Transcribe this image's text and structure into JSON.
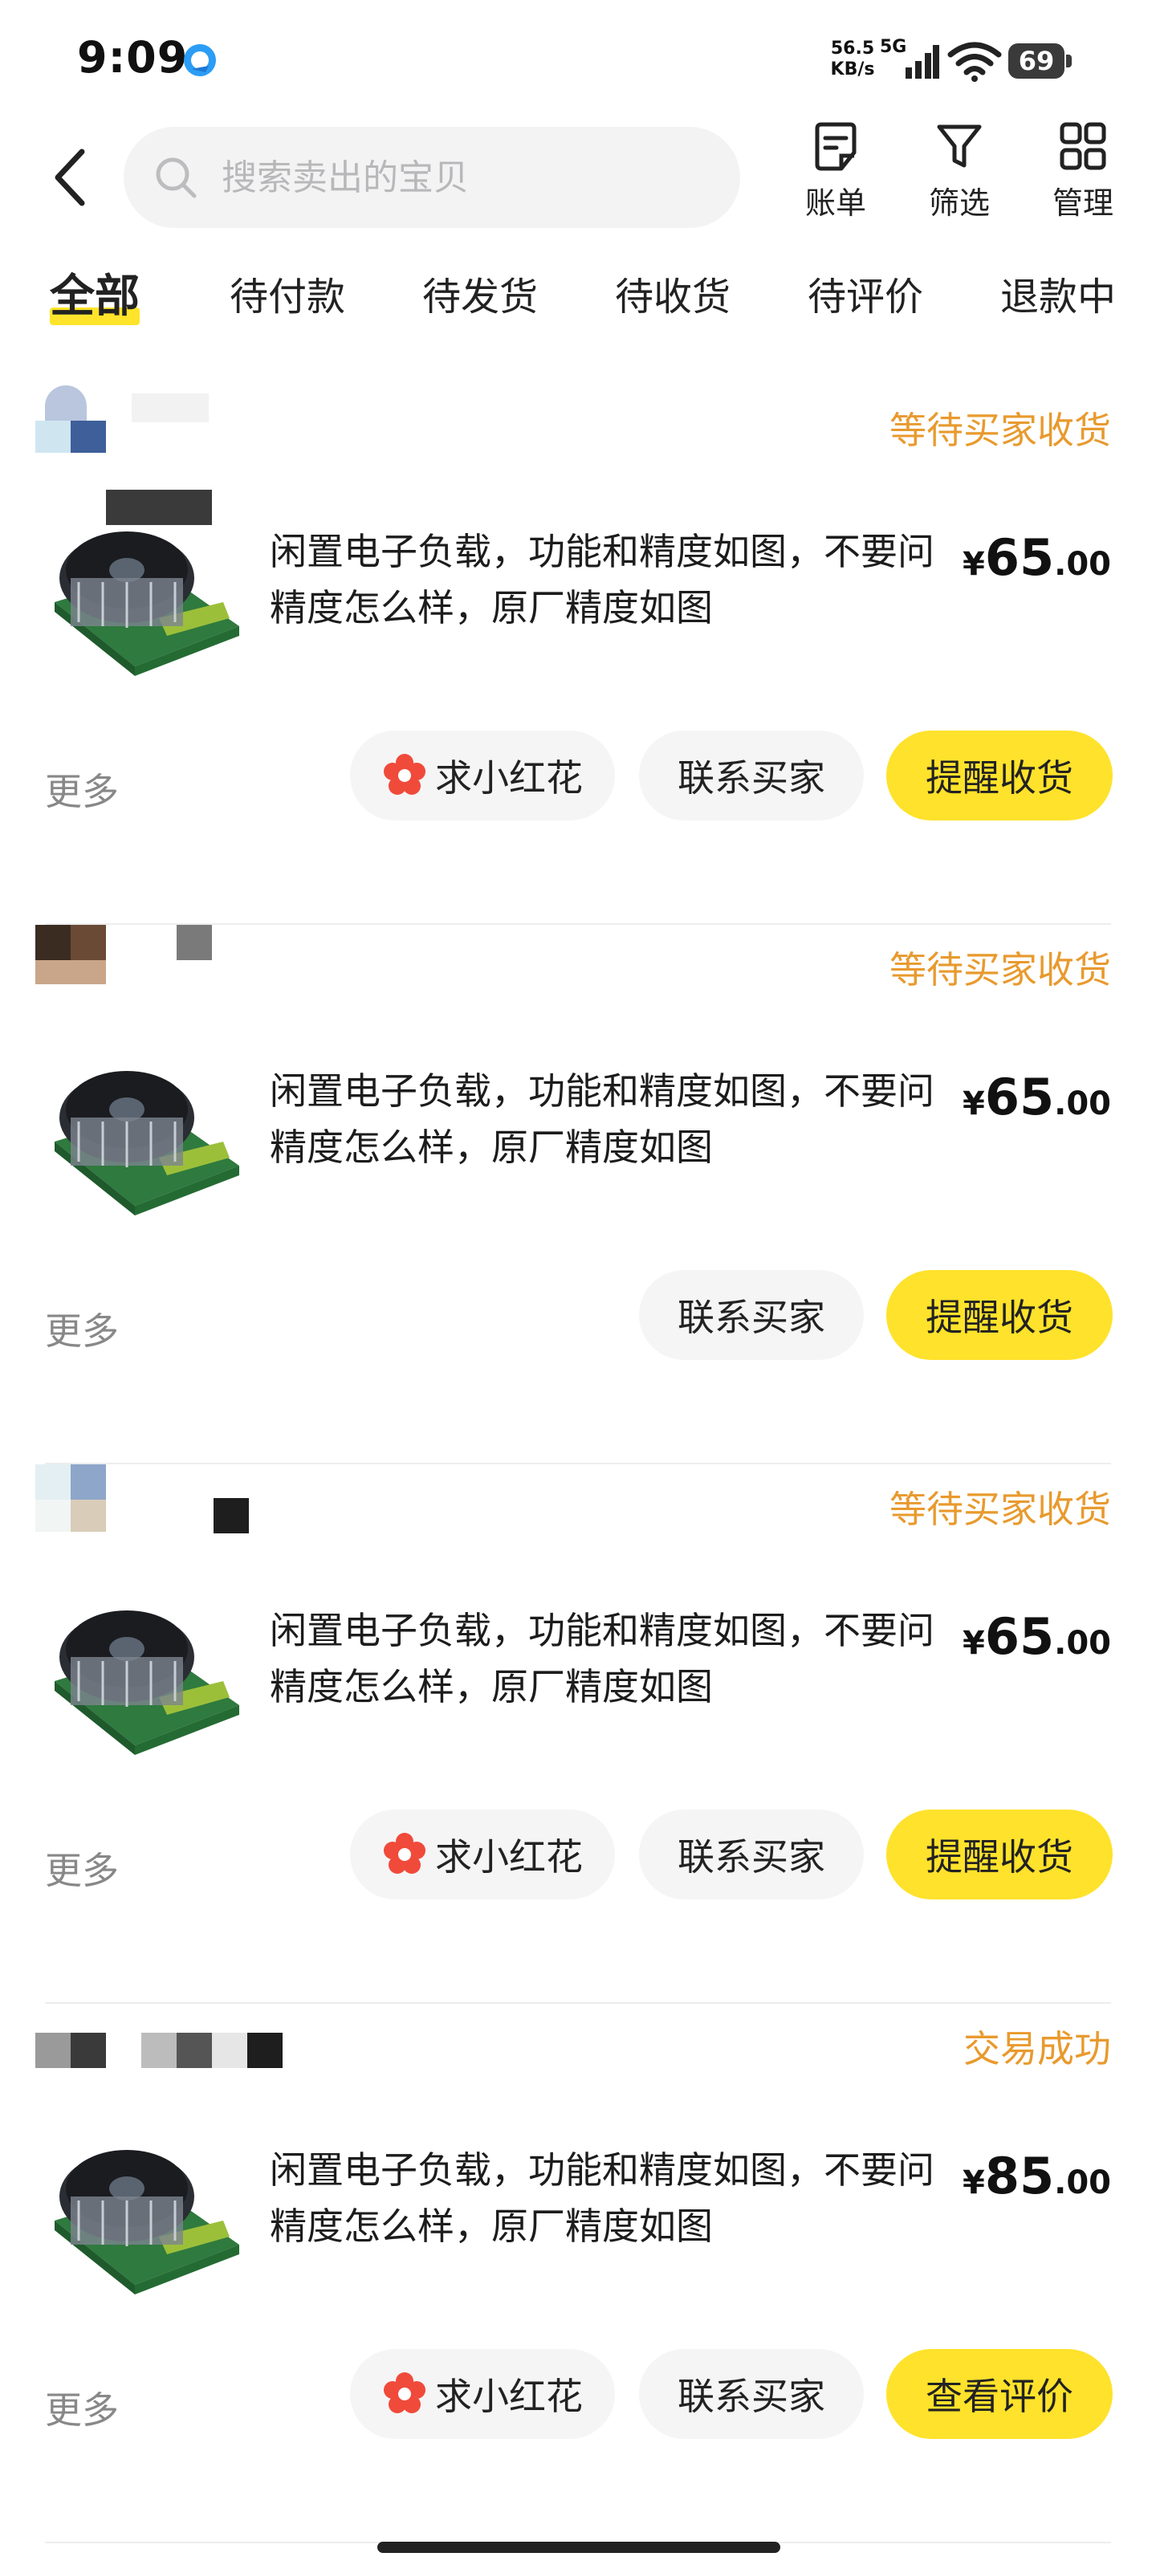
{
  "status_bar": {
    "time": "9:09",
    "net_speed_value": "56.5",
    "net_speed_unit": "KB/s",
    "network": "5G",
    "battery": "69",
    "app_icon": "qq-browser-icon"
  },
  "header": {
    "back_icon": "chevron-left-icon",
    "search_placeholder": "搜索卖出的宝贝",
    "actions": [
      {
        "label": "账单",
        "icon": "bill-icon"
      },
      {
        "label": "筛选",
        "icon": "filter-icon"
      },
      {
        "label": "管理",
        "icon": "grid-icon"
      }
    ]
  },
  "tabs": [
    {
      "label": "全部",
      "active": true
    },
    {
      "label": "待付款"
    },
    {
      "label": "待发货"
    },
    {
      "label": "待收货"
    },
    {
      "label": "待评价"
    },
    {
      "label": "退款中"
    }
  ],
  "orders": [
    {
      "status": "等待买家收货",
      "title": "闲置电子负载，功能和精度如图，不要问精度怎么样，原厂精度如图",
      "price_currency": "¥",
      "price_int": "65",
      "price_dec": ".00",
      "more": "更多",
      "buttons": [
        "求小红花",
        "联系买家",
        "提醒收货"
      ]
    },
    {
      "status": "等待买家收货",
      "title": "闲置电子负载，功能和精度如图，不要问精度怎么样，原厂精度如图",
      "price_currency": "¥",
      "price_int": "65",
      "price_dec": ".00",
      "more": "更多",
      "buttons": [
        "联系买家",
        "提醒收货"
      ]
    },
    {
      "status": "等待买家收货",
      "title": "闲置电子负载，功能和精度如图，不要问精度怎么样，原厂精度如图",
      "price_currency": "¥",
      "price_int": "65",
      "price_dec": ".00",
      "more": "更多",
      "buttons": [
        "求小红花",
        "联系买家",
        "提醒收货"
      ]
    },
    {
      "status": "交易成功",
      "title": "闲置电子负载，功能和精度如图，不要问精度怎么样，原厂精度如图",
      "price_currency": "¥",
      "price_int": "85",
      "price_dec": ".00",
      "more": "更多",
      "buttons": [
        "求小红花",
        "联系买家",
        "查看评价"
      ]
    }
  ],
  "colors": {
    "accent_yellow": "#ffe22b",
    "status_orange": "#e89a2e",
    "button_gray": "#f5f5f6"
  }
}
